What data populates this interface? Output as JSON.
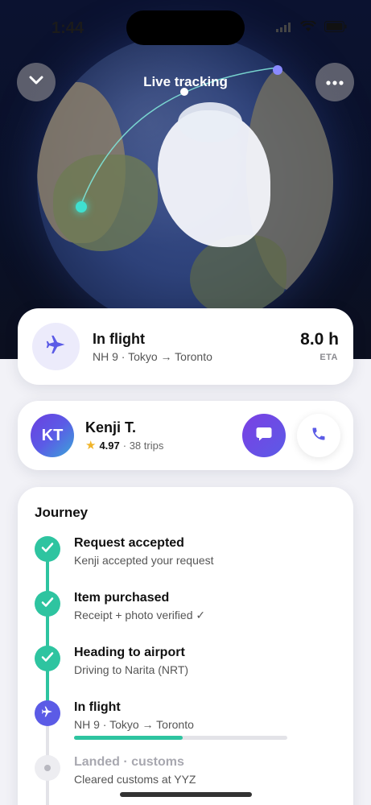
{
  "status_bar": {
    "time": "1:44"
  },
  "header": {
    "title": "Live tracking"
  },
  "icons": {
    "collapse": "chevron-down-icon",
    "more": "ellipsis-icon",
    "plane": "airplane-icon",
    "message": "chat-bubble-icon",
    "call": "phone-icon",
    "check": "checkmark-icon"
  },
  "flight_card": {
    "status": "In flight",
    "route": "NH 9 · Tokyo → Toronto",
    "eta_value": "8.0 h",
    "eta_label": "ETA"
  },
  "traveler": {
    "initials": "KT",
    "name": "Kenji T.",
    "rating": "4.97",
    "trips": "· 38 trips"
  },
  "journey": {
    "title": "Journey",
    "steps": [
      {
        "title": "Request accepted",
        "subtitle": "Kenji accepted your request",
        "state": "done"
      },
      {
        "title": "Item purchased",
        "subtitle": "Receipt + photo verified ✓",
        "state": "done"
      },
      {
        "title": "Heading to airport",
        "subtitle": "Driving to Narita (NRT)",
        "state": "done"
      },
      {
        "title": "In flight",
        "subtitle": "NH 9 · Tokyo → Toronto",
        "state": "active",
        "progress": 0.51
      },
      {
        "title": "Landed · customs",
        "subtitle": "Cleared customs at YYZ",
        "state": "pending"
      }
    ]
  },
  "colors": {
    "accent": "#5b5be6",
    "success": "#2ec4a0",
    "track": "#e3e3e8"
  }
}
